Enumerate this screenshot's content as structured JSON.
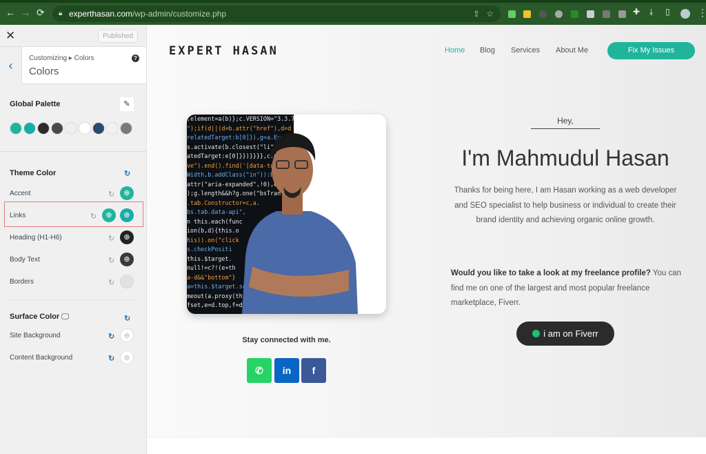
{
  "browser": {
    "url_host": "experthasan.com",
    "url_path": "/wp-admin/customize.php"
  },
  "customizer": {
    "published_label": "Published",
    "breadcrumb": "Customizing ▸ Colors",
    "title": "Colors",
    "global_palette": {
      "label": "Global Palette",
      "swatches": [
        "#1fb59b",
        "#17ada6",
        "#2b2b2b",
        "#4a4a4a",
        "#efefef",
        "#ffffff",
        "#2c4a6e",
        "#f2f2f2",
        "#7a7a7a"
      ]
    },
    "theme_color": {
      "label": "Theme Color",
      "items": [
        {
          "label": "Accent",
          "colors": [
            "#1fb59b"
          ]
        },
        {
          "label": "Links",
          "colors": [
            "#1fb59b",
            "#17ada6"
          ]
        },
        {
          "label": "Heading (H1-H6)",
          "colors": [
            "#222222"
          ]
        },
        {
          "label": "Body Text",
          "colors": [
            "#3a3a3a"
          ]
        },
        {
          "label": "Borders",
          "colors": [
            "#e2e2e2"
          ]
        }
      ]
    },
    "surface_color": {
      "label": "Surface Color",
      "items": [
        {
          "label": "Site Background"
        },
        {
          "label": "Content Background"
        }
      ]
    }
  },
  "site": {
    "logo": "EXPERT HASAN",
    "nav": [
      "Home",
      "Blog",
      "Services",
      "About Me"
    ],
    "cta": "Fix My Issues",
    "accent": "#1fb59b",
    "code_lines": [
      ".element=a(b)};c.VERSION=\"3.3.7",
      "\");if(d||(d=b.attr(\"href\"),d=d",
      "relatedTarget:b[0]}),g=a.Ev",
      "s.activate(b.closest(\"li\"),",
      "atedTarget:e[0]}})}}}},c.pr",
      "ve\").end().find('[data-toggl",
      "Width,b.addClass(\"in\")):b.re",
      "attr(\"aria-expanded\",!0),e&&e",
      ");g.length&&h?g.one(\"bsTran",
      ".tab.Constructor=c,a.",
      "bs.tab.data-api\",",
      "n this.each(func",
      "ion(b,d){this.o",
      "his)).on(\"click",
      "s.checkPositi",
      "this.$target.",
      "null!=c?!(e+th",
      "a-d&&\"bottom\"}",
      "a=this.$target.scrol",
      "meout(a.proxy(this.c",
      "fset,e=d.top,f=d.bot"
    ],
    "stay_connected": "Stay connected with me.",
    "social": [
      {
        "name": "whatsapp",
        "color": "#25d366"
      },
      {
        "name": "linkedin",
        "color": "#0a66c2"
      },
      {
        "name": "facebook",
        "color": "#3b5998"
      }
    ],
    "greeting": "Hey,",
    "headline": "I'm Mahmudul Hasan",
    "intro": "Thanks for being here, I am Hasan working as a web developer and SEO specialist to help business or individual to create their brand identity and achieving organic online growth.",
    "freelance_bold": "Would you like to take a look at my freelance profile?",
    "freelance_rest": " You can find me on one of the largest and most popular freelance marketplace, Fiverr.",
    "fiverr_button": "i am on Fiverr"
  }
}
